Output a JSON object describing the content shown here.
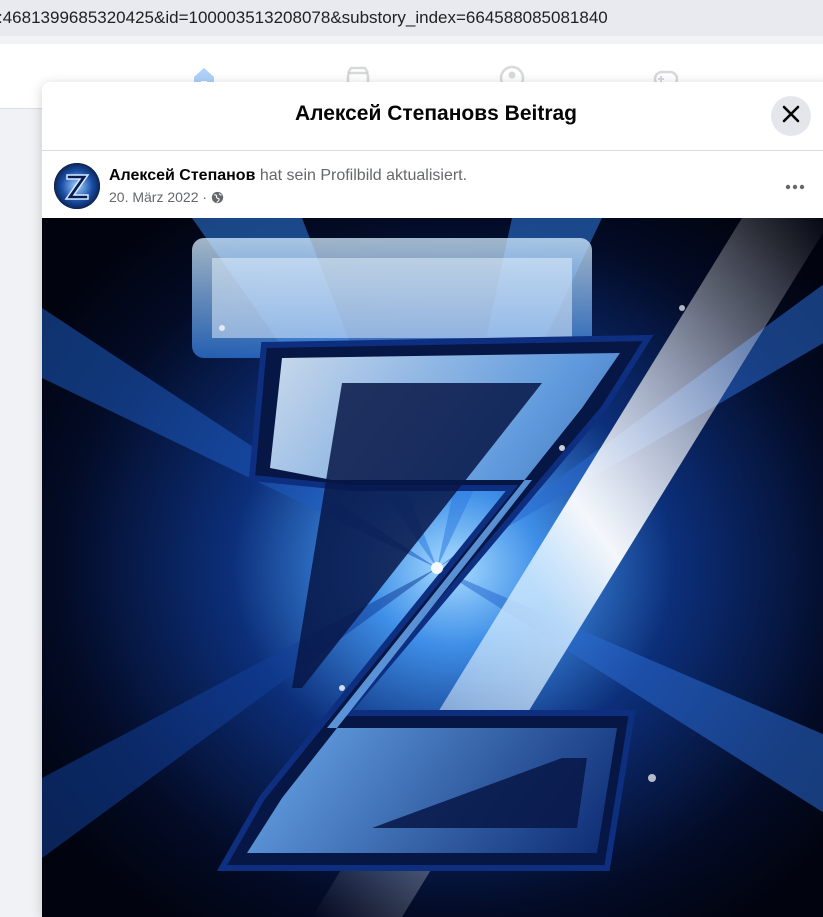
{
  "browser": {
    "url": ":4681399685320425&id=100003513208078&substory_index=664588085081840"
  },
  "nav": {
    "icons": [
      "home-icon",
      "marketplace-icon",
      "groups-icon",
      "gaming-icon"
    ]
  },
  "modal": {
    "title": "Алексей Степановs Beitrag",
    "close_icon": "close-icon"
  },
  "post": {
    "author": "Алексей Степанов",
    "action": " hat sein Profilbild aktualisiert.",
    "date": "20. März 2022",
    "separator": " · ",
    "audience_icon": "globe-icon",
    "more_icon": "more-options-icon"
  },
  "photo": {
    "subject": "Z",
    "colors": {
      "background": "#020716",
      "glow": "#5fb6ff",
      "letter_face": "#cfe6ff",
      "letter_dark": "#071646"
    }
  }
}
